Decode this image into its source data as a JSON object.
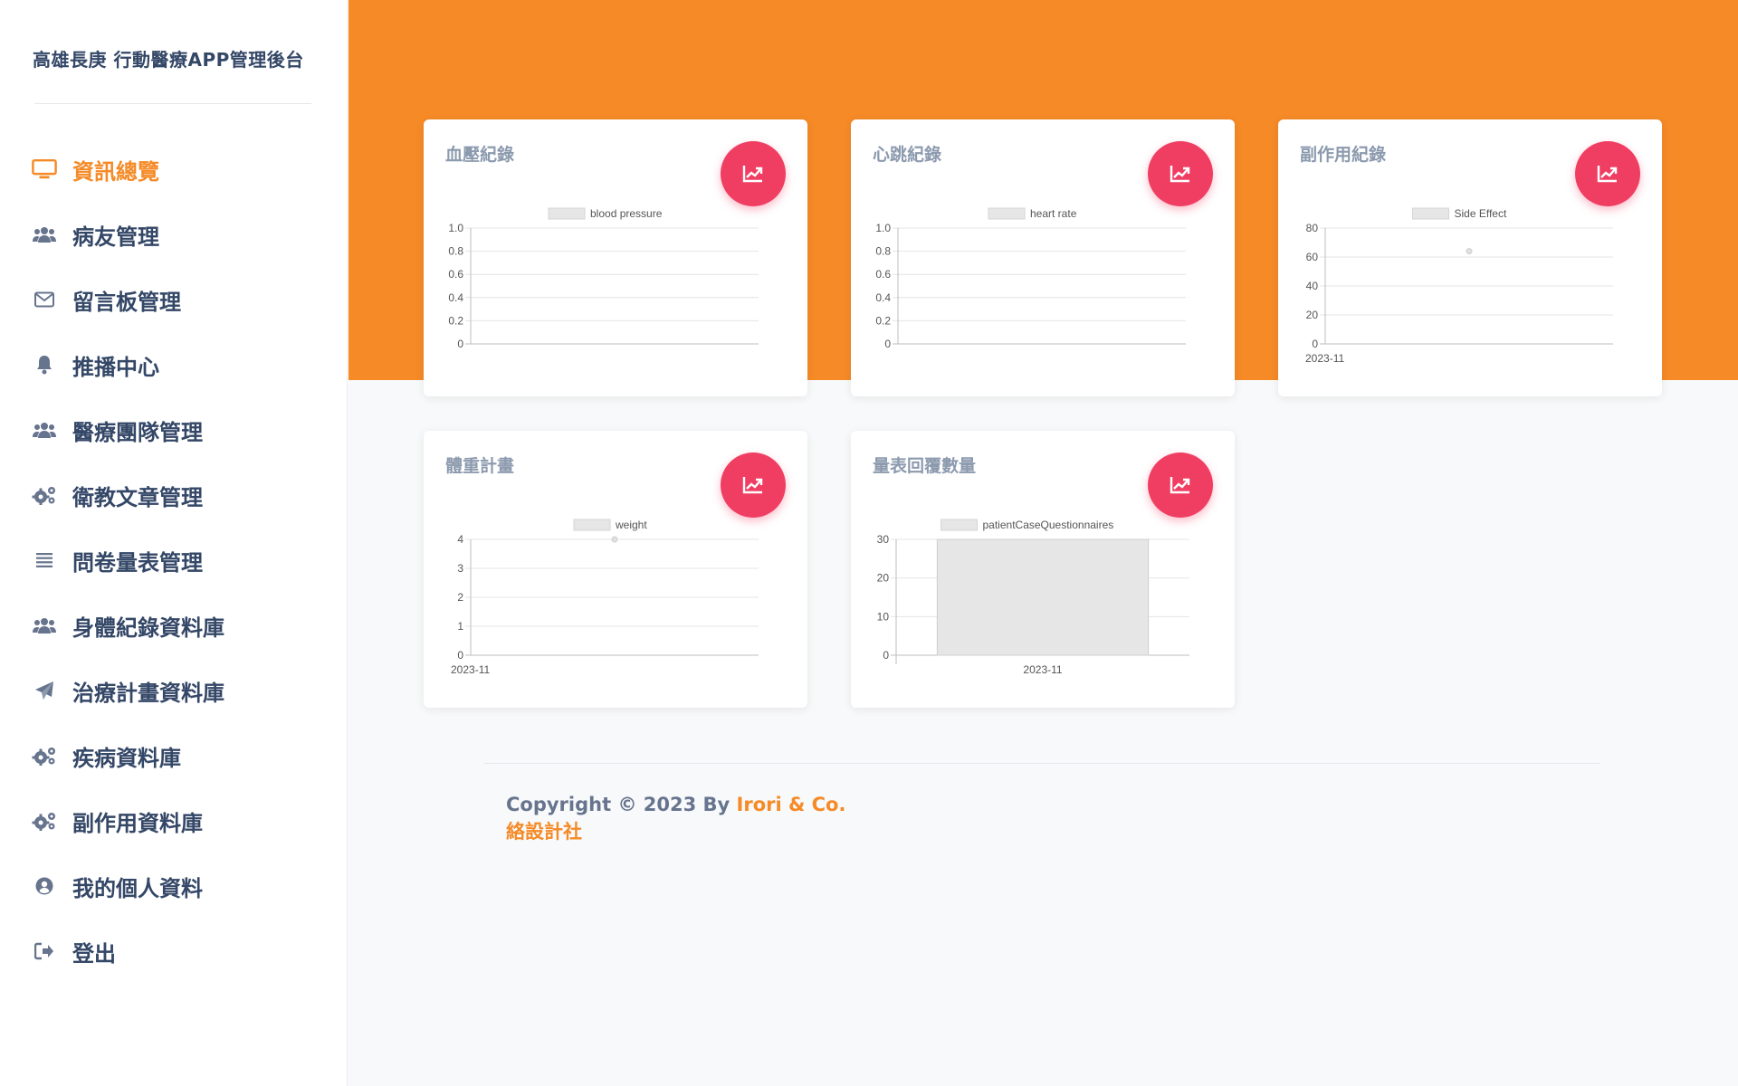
{
  "sidebar": {
    "brand": "高雄長庚 行動醫療APP管理後台",
    "items": [
      {
        "label": "資訊總覽",
        "icon": "monitor-icon",
        "active": true
      },
      {
        "label": "病友管理",
        "icon": "users-icon"
      },
      {
        "label": "留言板管理",
        "icon": "envelope-icon"
      },
      {
        "label": "推播中心",
        "icon": "bell-icon"
      },
      {
        "label": "醫療團隊管理",
        "icon": "users-icon"
      },
      {
        "label": "衛教文章管理",
        "icon": "gears-icon"
      },
      {
        "label": "問卷量表管理",
        "icon": "list-icon"
      },
      {
        "label": "身體紀錄資料庫",
        "icon": "users-icon"
      },
      {
        "label": "治療計畫資料庫",
        "icon": "paper-plane-icon"
      },
      {
        "label": "疾病資料庫",
        "icon": "gears-icon"
      },
      {
        "label": "副作用資料庫",
        "icon": "gears-icon"
      },
      {
        "label": "我的個人資料",
        "icon": "user-circle-icon"
      },
      {
        "label": "登出",
        "icon": "sign-out-icon"
      }
    ]
  },
  "colors": {
    "accent": "#f58a27",
    "button": "#f03e63",
    "legend_fill": "#e6e6e6",
    "text": "#344767"
  },
  "cards": [
    {
      "title": "血壓紀錄",
      "icon": "chart-line-icon"
    },
    {
      "title": "心跳紀錄",
      "icon": "chart-line-icon"
    },
    {
      "title": "副作用紀錄",
      "icon": "chart-line-icon"
    },
    {
      "title": "體重計畫",
      "icon": "chart-line-icon"
    },
    {
      "title": "量表回覆數量",
      "icon": "chart-line-icon"
    }
  ],
  "chart_data": [
    {
      "type": "line",
      "legend": [
        "blood pressure"
      ],
      "series": [
        {
          "name": "blood pressure",
          "values": []
        }
      ],
      "x": [],
      "yticks": [
        "1.0",
        "0.8",
        "0.6",
        "0.4",
        "0.2",
        "0"
      ],
      "ylim": [
        0,
        1
      ]
    },
    {
      "type": "line",
      "legend": [
        "heart rate"
      ],
      "series": [
        {
          "name": "heart rate",
          "values": []
        }
      ],
      "x": [],
      "yticks": [
        "1.0",
        "0.8",
        "0.6",
        "0.4",
        "0.2",
        "0"
      ],
      "ylim": [
        0,
        1
      ]
    },
    {
      "type": "line",
      "legend": [
        "Side Effect"
      ],
      "series": [
        {
          "name": "Side Effect",
          "values": [
            64
          ]
        }
      ],
      "x": [
        "2023-11"
      ],
      "yticks": [
        "80",
        "60",
        "40",
        "20",
        "0"
      ],
      "ylim": [
        0,
        80
      ]
    },
    {
      "type": "line",
      "legend": [
        "weight"
      ],
      "series": [
        {
          "name": "weight",
          "values": [
            4
          ]
        }
      ],
      "x": [
        "2023-11"
      ],
      "yticks": [
        "4",
        "3",
        "2",
        "1",
        "0"
      ],
      "ylim": [
        0,
        4
      ]
    },
    {
      "type": "bar",
      "legend": [
        "patientCaseQuestionnaires"
      ],
      "series": [
        {
          "name": "patientCaseQuestionnaires",
          "values": [
            30
          ]
        }
      ],
      "x": [
        "2023-11"
      ],
      "yticks": [
        "30",
        "20",
        "10",
        "0"
      ],
      "ylim": [
        0,
        30
      ]
    }
  ],
  "footer": {
    "prefix": "Copyright © 2023 By ",
    "company": "Irori & Co. 絡設計社"
  }
}
